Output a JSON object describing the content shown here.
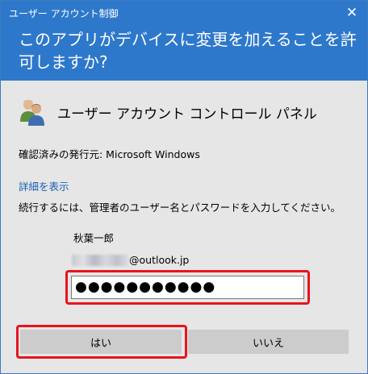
{
  "window": {
    "title": "ユーザー アカウント制御",
    "close_glyph": "✕"
  },
  "header": {
    "question": "このアプリがデバイスに変更を加えることを許可しますか?"
  },
  "app": {
    "name": "ユーザー アカウント コントロール パネル",
    "icon": "users-icon"
  },
  "publisher": "確認済みの発行元: Microsoft Windows",
  "details_link": "詳細を表示",
  "instruction": "続行するには、管理者のユーザー名とパスワードを入力してください。",
  "credentials": {
    "user_name": "秋葉一郎",
    "account_domain": "@outlook.jp",
    "password_mask": "●●●●●●●●●●●"
  },
  "buttons": {
    "yes": "はい",
    "no": "いいえ"
  },
  "colors": {
    "header_bg": "#2e78cc",
    "highlight": "#e8141e",
    "body_bg": "#e6e6e6"
  }
}
